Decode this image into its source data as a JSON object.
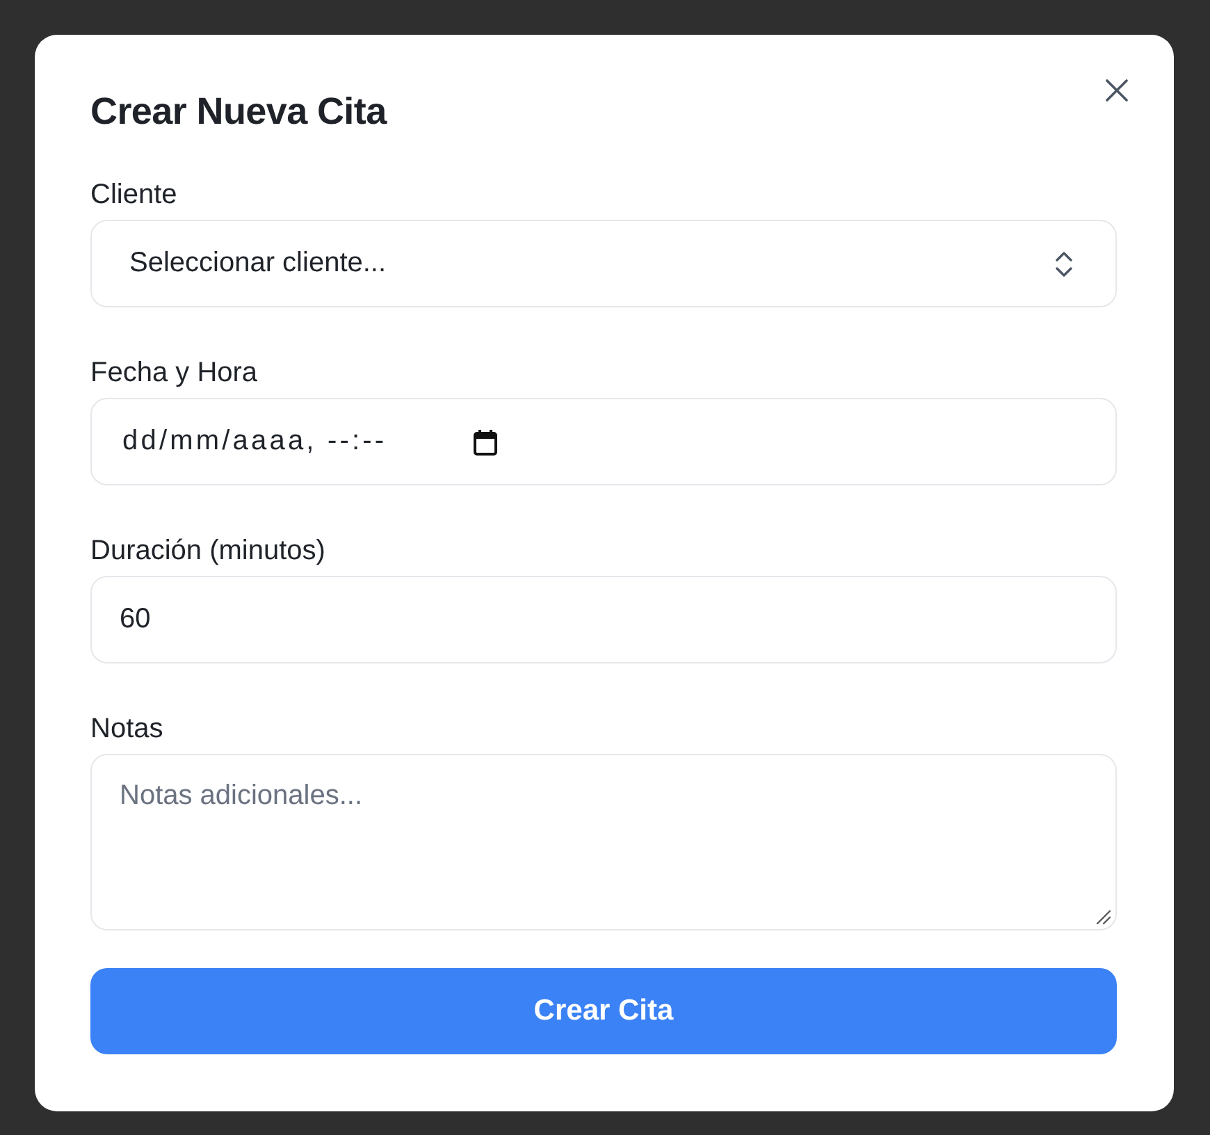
{
  "dialog": {
    "title": "Crear Nueva Cita"
  },
  "fields": [
    {
      "kind": "select",
      "label": "Cliente",
      "value": "Seleccionar cliente..."
    },
    {
      "kind": "datetime",
      "label": "Fecha y Hora",
      "placeholder": "dd/mm/aaaa, --:--"
    },
    {
      "kind": "number",
      "label": "Duración (minutos)",
      "value": "60"
    },
    {
      "kind": "textarea",
      "label": "Notas",
      "placeholder": "Notas adicionales..."
    }
  ],
  "submit_button": {
    "label": "Crear Cita"
  }
}
